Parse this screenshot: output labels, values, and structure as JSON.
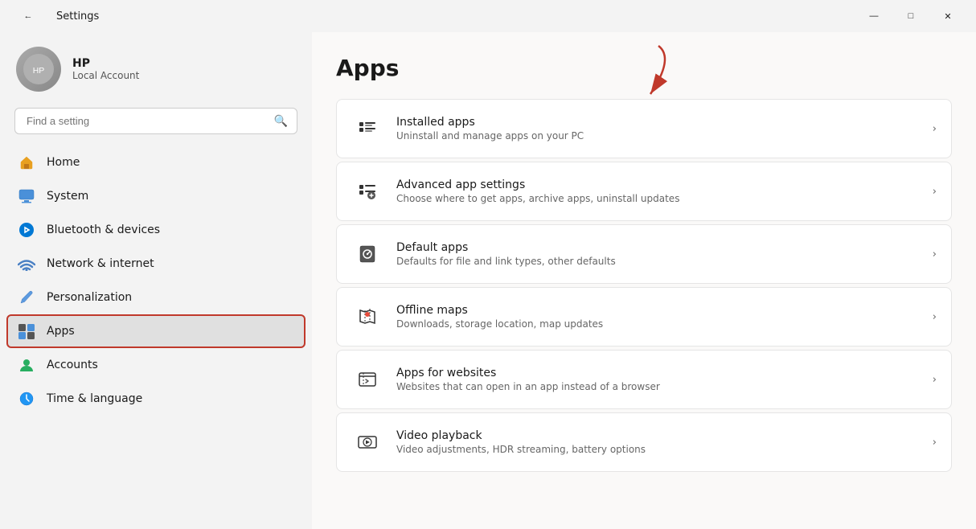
{
  "titlebar": {
    "back_label": "←",
    "title": "Settings",
    "minimize_label": "—",
    "maximize_label": "□",
    "close_label": "✕"
  },
  "sidebar": {
    "user": {
      "name": "HP",
      "sub": "Local Account"
    },
    "search": {
      "placeholder": "Find a setting"
    },
    "nav_items": [
      {
        "id": "home",
        "label": "Home",
        "icon": "🏠"
      },
      {
        "id": "system",
        "label": "System",
        "icon": "🖥️"
      },
      {
        "id": "bluetooth",
        "label": "Bluetooth & devices",
        "icon": "🔵"
      },
      {
        "id": "network",
        "label": "Network & internet",
        "icon": "💎"
      },
      {
        "id": "personalization",
        "label": "Personalization",
        "icon": "✏️"
      },
      {
        "id": "apps",
        "label": "Apps",
        "icon": "📦",
        "active": true
      },
      {
        "id": "accounts",
        "label": "Accounts",
        "icon": "👤"
      },
      {
        "id": "time",
        "label": "Time & language",
        "icon": "🌐"
      }
    ]
  },
  "main": {
    "title": "Apps",
    "items": [
      {
        "id": "installed-apps",
        "label": "Installed apps",
        "desc": "Uninstall and manage apps on your PC",
        "icon": "installed"
      },
      {
        "id": "advanced-app-settings",
        "label": "Advanced app settings",
        "desc": "Choose where to get apps, archive apps, uninstall updates",
        "icon": "advanced"
      },
      {
        "id": "default-apps",
        "label": "Default apps",
        "desc": "Defaults for file and link types, other defaults",
        "icon": "default"
      },
      {
        "id": "offline-maps",
        "label": "Offline maps",
        "desc": "Downloads, storage location, map updates",
        "icon": "maps"
      },
      {
        "id": "apps-for-websites",
        "label": "Apps for websites",
        "desc": "Websites that can open in an app instead of a browser",
        "icon": "websites"
      },
      {
        "id": "video-playback",
        "label": "Video playback",
        "desc": "Video adjustments, HDR streaming, battery options",
        "icon": "video"
      }
    ]
  }
}
